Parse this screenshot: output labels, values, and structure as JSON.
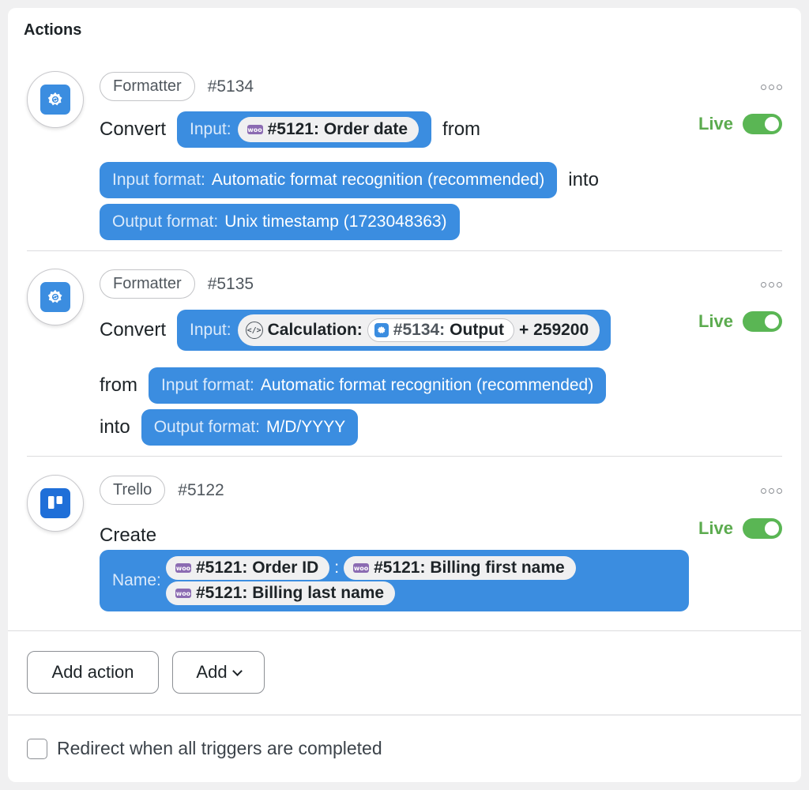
{
  "heading": "Actions",
  "live_label": "Live",
  "actions": [
    {
      "tag": "Formatter",
      "id": "#5134",
      "verb": "Convert",
      "input_key": "Input:",
      "input_chip": "#5121: Order date",
      "from_word": "from",
      "input_format_key": "Input format:",
      "input_format_value": "Automatic format recognition (recommended)",
      "into_word": "into",
      "output_format_key": "Output format:",
      "output_format_value": "Unix timestamp (1723048363)"
    },
    {
      "tag": "Formatter",
      "id": "#5135",
      "verb": "Convert",
      "input_key": "Input:",
      "calc_label": "Calculation:",
      "calc_ref_id": "#5134:",
      "calc_ref_name": "Output",
      "calc_suffix": "+ 259200",
      "from_word": "from",
      "input_format_key": "Input format:",
      "input_format_value": "Automatic format recognition (recommended)",
      "into_word": "into",
      "output_format_key": "Output format:",
      "output_format_value": "M/D/YYYY"
    },
    {
      "tag": "Trello",
      "id": "#5122",
      "verb": "Create",
      "name_key": "Name:",
      "chips": [
        "#5121: Order ID",
        "#5121: Billing first name",
        "#5121: Billing last name"
      ],
      "separator": ":"
    }
  ],
  "woo_icon_text": "woo",
  "buttons": {
    "add_action": "Add action",
    "add": "Add"
  },
  "redirect_label": "Redirect when all triggers are completed",
  "colors": {
    "token_blue": "#3b8de0",
    "live_green": "#5cab4f",
    "woo_purple": "#8b6bb2"
  }
}
